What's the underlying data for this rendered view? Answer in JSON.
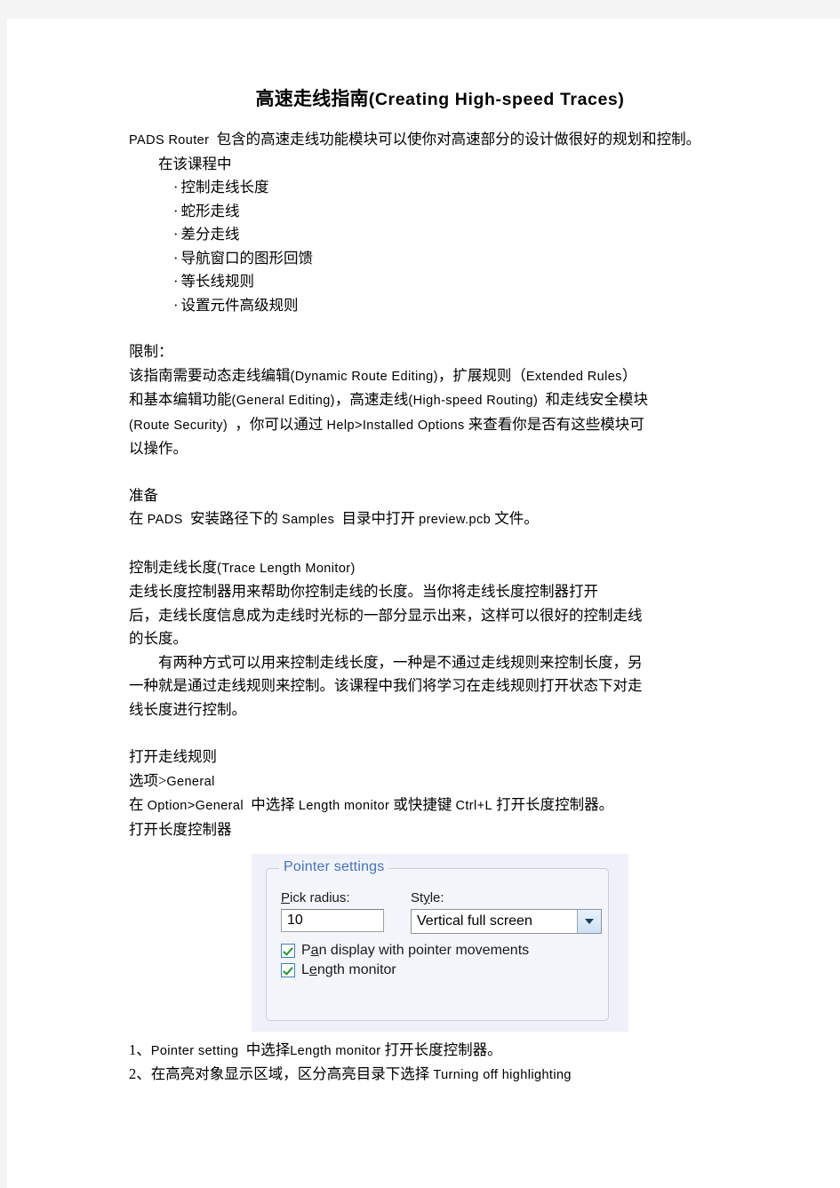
{
  "document": {
    "title_cn": "高速走线指南",
    "title_en": "(Creating High-speed Traces)",
    "intro_en": "PADS Router",
    "intro_cn": "包含的高速走线功能模块可以使你对高速部分的设计做很好的规划和控制。",
    "intro_line2": "在该课程中",
    "bullets": [
      "控制走线长度",
      "蛇形走线",
      "差分走线",
      "导航窗口的图形回馈",
      "等长线规则",
      "设置元件高级规则"
    ],
    "bullet_marker": "·",
    "limits_heading": "限制：",
    "limits_l1_a": "该指南需要动态走线编辑",
    "limits_l1_b": "(Dynamic Route Editing)",
    "limits_l1_c": "，扩展规则（",
    "limits_l1_d": "Extended Rules",
    "limits_l1_e": "）",
    "limits_l2_a": "和基本编辑功能",
    "limits_l2_b": "(General Editing)",
    "limits_l2_c": "，高速走线",
    "limits_l2_d": "(High-speed Routing)",
    "limits_l2_e": "和走线安全模块",
    "limits_l3_a": "(Route Security)",
    "limits_l3_b": "，你可以通过",
    "limits_l3_c": "Help>Installed Options",
    "limits_l3_d": "来查看你是否有这些模块可",
    "limits_l4": "以操作。",
    "prep_heading": "准备",
    "prep_a": "在",
    "prep_b": "PADS",
    "prep_c": "安装路径下的",
    "prep_d": "Samples",
    "prep_e": "目录中打开",
    "prep_f": "preview.pcb",
    "prep_g": "文件。",
    "tlm_heading_cn": "控制走线长度",
    "tlm_heading_en": "(Trace Length Monitor)",
    "tlm_l1": "走线长度控制器用来帮助你控制走线的长度。当你将走线长度控制器打开",
    "tlm_l2": "后，走线长度信息成为走线时光标的一部分显示出来，这样可以很好的控制走线",
    "tlm_l3": "的长度。",
    "tlm_p2_l1": "有两种方式可以用来控制走线长度，一种是不通过走线规则来控制长度，另",
    "tlm_p2_l2": "一种就是通过走线规则来控制。该课程中我们将学习在走线规则打开状态下对走",
    "tlm_p2_l3": "线长度进行控制。",
    "open_rules_heading": "打开走线规则",
    "open_rules_l1_a": "选项>",
    "open_rules_l1_b": "General",
    "open_rules_l2_a": "在",
    "open_rules_l2_b": "Option>General",
    "open_rules_l2_c": "中选择",
    "open_rules_l2_d": "Length monitor",
    "open_rules_l2_e": "或快捷键",
    "open_rules_l2_f": "Ctrl+L",
    "open_rules_l2_g": "打开长度控制器。",
    "open_rules_l3": "打开长度控制器",
    "steps": [
      {
        "num": "1、",
        "en1": "Pointer setting",
        "cn1": "中选择",
        "en2": "Length monitor",
        "cn2": "打开长度控制器。"
      },
      {
        "num": "2、",
        "cn1": "在高亮对象显示区域，区分高亮目录下选择",
        "en1": "Turning off highlighting"
      }
    ]
  },
  "dialog": {
    "group_title": "Pointer settings",
    "pick_radius_label_u": "P",
    "pick_radius_label_rest": "ick radius:",
    "pick_radius_value": "10",
    "style_label_a": "St",
    "style_label_u": "y",
    "style_label_rest": "le:",
    "style_value": "Vertical full screen",
    "checkbox_pan_a": "P",
    "checkbox_pan_u": "a",
    "checkbox_pan_rest": "n display with pointer movements",
    "checkbox_len_a": "L",
    "checkbox_len_u": "e",
    "checkbox_len_rest": "ngth monitor",
    "accent_color": "#4472c4",
    "check_color": "#1d9a2a"
  }
}
